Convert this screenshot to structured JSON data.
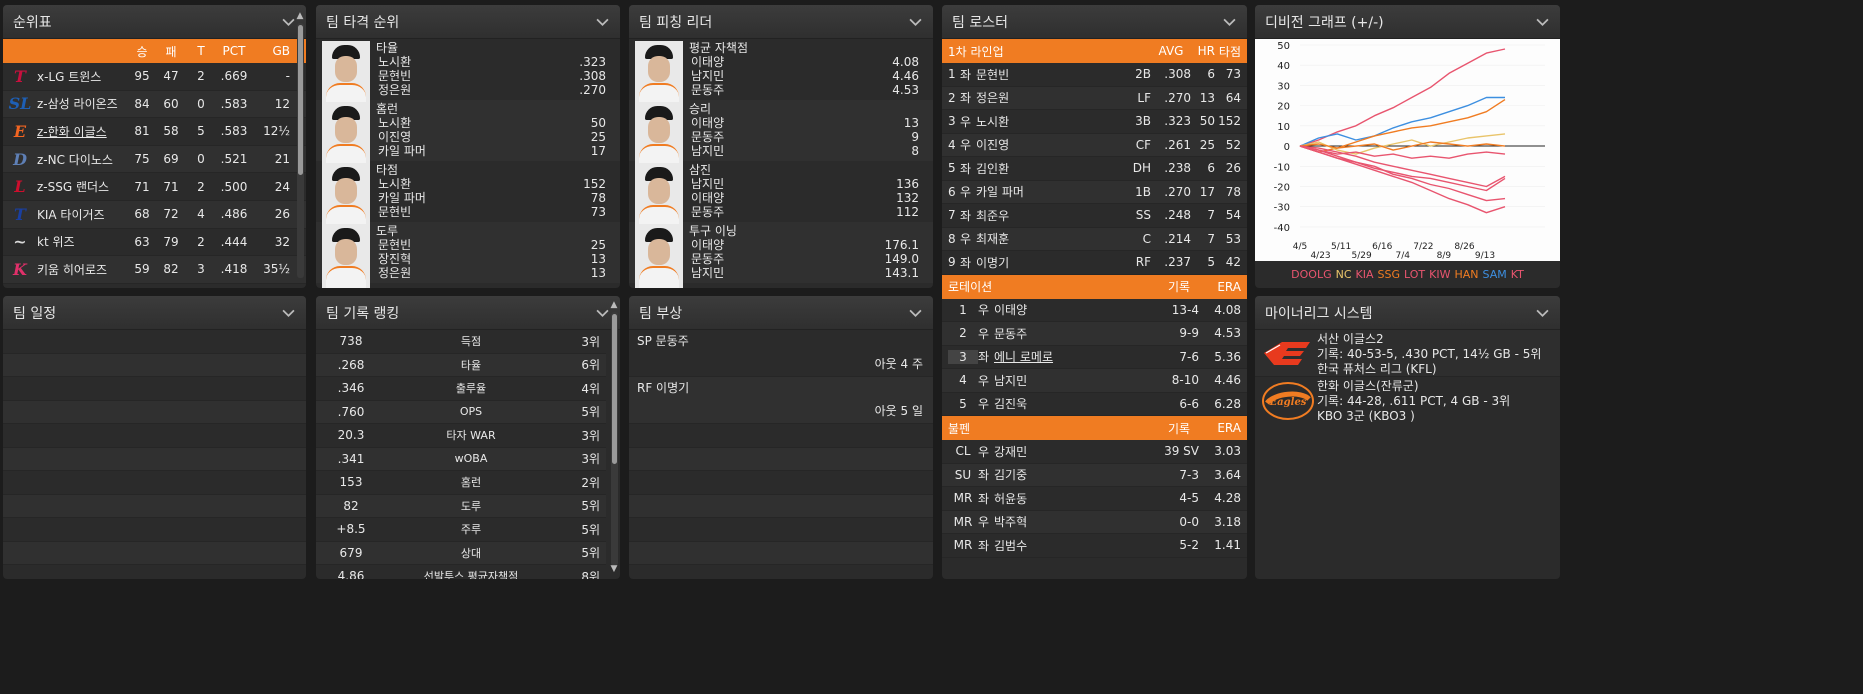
{
  "standings": {
    "title": "순위표",
    "headers": [
      "승",
      "패",
      "T",
      "PCT",
      "GB"
    ],
    "rows": [
      {
        "logo": "T",
        "logo_color": "#c8103e",
        "name": "x-LG 트윈스",
        "w": "95",
        "l": "47",
        "t": "2",
        "pct": ".669",
        "gb": "-"
      },
      {
        "logo": "SL",
        "logo_color": "#1e5fb5",
        "name": "z-삼성 라이온즈",
        "w": "84",
        "l": "60",
        "t": "0",
        "pct": ".583",
        "gb": "12"
      },
      {
        "logo": "E",
        "logo_color": "#f26522",
        "name": "z-한화 이글스",
        "w": "81",
        "l": "58",
        "t": "5",
        "pct": ".583",
        "gb": "12½"
      },
      {
        "logo": "D",
        "logo_color": "#5e7fb5",
        "name": "z-NC 다이노스",
        "w": "75",
        "l": "69",
        "t": "0",
        "pct": ".521",
        "gb": "21"
      },
      {
        "logo": "L",
        "logo_color": "#ce0e2d",
        "name": "z-SSG 랜더스",
        "w": "71",
        "l": "71",
        "t": "2",
        "pct": ".500",
        "gb": "24"
      },
      {
        "logo": "T",
        "logo_color": "#1a3fa0",
        "name": "KIA 타이거즈",
        "w": "68",
        "l": "72",
        "t": "4",
        "pct": ".486",
        "gb": "26"
      },
      {
        "logo": "~",
        "logo_color": "#d8d8d8",
        "name": "kt 위즈",
        "w": "63",
        "l": "79",
        "t": "2",
        "pct": ".444",
        "gb": "32"
      },
      {
        "logo": "K",
        "logo_color": "#e0306a",
        "name": "키움 히어로즈",
        "w": "59",
        "l": "82",
        "t": "3",
        "pct": ".418",
        "gb": "35½"
      }
    ]
  },
  "batting": {
    "title": "팀 타격 순위",
    "blocks": [
      {
        "cat": "타율",
        "lines": [
          {
            "name": "노시환",
            "val": ".323"
          },
          {
            "name": "문현빈",
            "val": ".308"
          },
          {
            "name": "정은원",
            "val": ".270"
          }
        ]
      },
      {
        "cat": "홈런",
        "lines": [
          {
            "name": "노시환",
            "val": "50"
          },
          {
            "name": "이진영",
            "val": "25"
          },
          {
            "name": "카일 파머",
            "val": "17"
          }
        ]
      },
      {
        "cat": "타점",
        "lines": [
          {
            "name": "노시환",
            "val": "152"
          },
          {
            "name": "카일 파머",
            "val": "78"
          },
          {
            "name": "문현빈",
            "val": "73"
          }
        ]
      },
      {
        "cat": "도루",
        "lines": [
          {
            "name": "문현빈",
            "val": "25"
          },
          {
            "name": "장진혁",
            "val": "13"
          },
          {
            "name": "정은원",
            "val": "13"
          }
        ]
      }
    ]
  },
  "pitching": {
    "title": "팀 피칭 리더",
    "blocks": [
      {
        "cat": "평균 자책점",
        "lines": [
          {
            "name": "이태양",
            "val": "4.08"
          },
          {
            "name": "남지민",
            "val": "4.46"
          },
          {
            "name": "문동주",
            "val": "4.53"
          }
        ]
      },
      {
        "cat": "승리",
        "lines": [
          {
            "name": "이태양",
            "val": "13"
          },
          {
            "name": "문동주",
            "val": "9"
          },
          {
            "name": "남지민",
            "val": "8"
          }
        ]
      },
      {
        "cat": "삼진",
        "lines": [
          {
            "name": "남지민",
            "val": "136"
          },
          {
            "name": "이태양",
            "val": "132"
          },
          {
            "name": "문동주",
            "val": "112"
          }
        ]
      },
      {
        "cat": "투구 이닝",
        "lines": [
          {
            "name": "이태양",
            "val": "176.1"
          },
          {
            "name": "문동주",
            "val": "149.0"
          },
          {
            "name": "남지민",
            "val": "143.1"
          }
        ]
      }
    ]
  },
  "roster": {
    "title": "팀 로스터",
    "lineup_header": {
      "label": "1차 라인업",
      "avg": "AVG",
      "hr": "HR",
      "rbi": "타점"
    },
    "lineup": [
      {
        "no": "1",
        "hand": "좌",
        "name": "문현빈",
        "pos": "2B",
        "avg": ".308",
        "hr": "6",
        "rbi": "73"
      },
      {
        "no": "2",
        "hand": "좌",
        "name": "정은원",
        "pos": "LF",
        "avg": ".270",
        "hr": "13",
        "rbi": "64"
      },
      {
        "no": "3",
        "hand": "우",
        "name": "노시환",
        "pos": "3B",
        "avg": ".323",
        "hr": "50",
        "rbi": "152"
      },
      {
        "no": "4",
        "hand": "우",
        "name": "이진영",
        "pos": "CF",
        "avg": ".261",
        "hr": "25",
        "rbi": "52"
      },
      {
        "no": "5",
        "hand": "좌",
        "name": "김인환",
        "pos": "DH",
        "avg": ".238",
        "hr": "6",
        "rbi": "26"
      },
      {
        "no": "6",
        "hand": "우",
        "name": "카일 파머",
        "pos": "1B",
        "avg": ".270",
        "hr": "17",
        "rbi": "78"
      },
      {
        "no": "7",
        "hand": "좌",
        "name": "최준우",
        "pos": "SS",
        "avg": ".248",
        "hr": "7",
        "rbi": "54"
      },
      {
        "no": "8",
        "hand": "우",
        "name": "최재훈",
        "pos": "C",
        "avg": ".214",
        "hr": "7",
        "rbi": "53"
      },
      {
        "no": "9",
        "hand": "좌",
        "name": "이명기",
        "pos": "RF",
        "avg": ".237",
        "hr": "5",
        "rbi": "42"
      }
    ],
    "rotation_header": {
      "label": "로테이션",
      "rec": "기록",
      "era": "ERA"
    },
    "rotation": [
      {
        "no": "1",
        "hand": "우",
        "name": "이태양",
        "rec": "13-4",
        "era": "4.08"
      },
      {
        "no": "2",
        "hand": "우",
        "name": "문동주",
        "rec": "9-9",
        "era": "4.53"
      },
      {
        "no": "3",
        "hand": "좌",
        "name": "에니 로메로",
        "rec": "7-6",
        "era": "5.36"
      },
      {
        "no": "4",
        "hand": "우",
        "name": "남지민",
        "rec": "8-10",
        "era": "4.46"
      },
      {
        "no": "5",
        "hand": "우",
        "name": "김진욱",
        "rec": "6-6",
        "era": "6.28"
      }
    ],
    "bullpen_header": {
      "label": "불펜",
      "rec": "기록",
      "era": "ERA"
    },
    "bullpen": [
      {
        "role": "CL",
        "hand": "우",
        "name": "강재민",
        "rec": "39 SV",
        "era": "3.03"
      },
      {
        "role": "SU",
        "hand": "좌",
        "name": "김기중",
        "rec": "7-3",
        "era": "3.64"
      },
      {
        "role": "MR",
        "hand": "좌",
        "name": "허윤동",
        "rec": "4-5",
        "era": "4.28"
      },
      {
        "role": "MR",
        "hand": "우",
        "name": "박주혁",
        "rec": "0-0",
        "era": "3.18"
      },
      {
        "role": "MR",
        "hand": "좌",
        "name": "김범수",
        "rec": "5-2",
        "era": "1.41"
      }
    ]
  },
  "division_graph": {
    "title": "디비전 그래프 (+/-)",
    "legend": [
      {
        "label": "DOOLG",
        "color": "#e8556f"
      },
      {
        "label": "NC",
        "color": "#e9c46a"
      },
      {
        "label": "KIA",
        "color": "#e8556f"
      },
      {
        "label": "SSG",
        "color": "#f07c22"
      },
      {
        "label": "LOT",
        "color": "#e8556f"
      },
      {
        "label": "KIW",
        "color": "#e8556f"
      },
      {
        "label": "HAN",
        "color": "#f07c22"
      },
      {
        "label": "SAM",
        "color": "#3d8fe0"
      },
      {
        "label": "KT",
        "color": "#e8556f"
      }
    ]
  },
  "chart_data": {
    "type": "line",
    "title": "디비전 그래프 (+/-)",
    "x_ticks": [
      "4/5",
      "4/23",
      "5/11",
      "5/29",
      "6/16",
      "7/4",
      "7/22",
      "8/9",
      "8/26",
      "9/13"
    ],
    "y_ticks": [
      50,
      40,
      30,
      20,
      10,
      0,
      -10,
      -20,
      -30,
      -40
    ],
    "ylim": [
      -45,
      50
    ],
    "series": [
      {
        "name": "LG",
        "color": "#e8556f",
        "values": [
          0,
          3,
          7,
          10,
          15,
          19,
          24,
          29,
          36,
          41,
          46,
          48
        ]
      },
      {
        "name": "SAM",
        "color": "#3d8fe0",
        "values": [
          0,
          4,
          6,
          3,
          5,
          9,
          12,
          14,
          17,
          20,
          24,
          24
        ]
      },
      {
        "name": "HAN",
        "color": "#f07c22",
        "values": [
          0,
          -3,
          -1,
          2,
          5,
          7,
          9,
          10,
          12,
          14,
          17,
          23
        ]
      },
      {
        "name": "NC",
        "color": "#e9c46a",
        "values": [
          0,
          2,
          -2,
          -4,
          -1,
          1,
          3,
          0,
          2,
          4,
          5,
          6
        ]
      },
      {
        "name": "SSG",
        "color": "#f07c22",
        "values": [
          0,
          1,
          -1,
          0,
          1,
          -2,
          0,
          2,
          1,
          0,
          1,
          0
        ]
      },
      {
        "name": "KIA",
        "color": "#e8556f",
        "values": [
          0,
          -2,
          -4,
          -3,
          -5,
          -4,
          -6,
          -5,
          -6,
          -4,
          -3,
          -4
        ]
      },
      {
        "name": "DOO",
        "color": "#e8556f",
        "values": [
          0,
          -1,
          -3,
          -5,
          -8,
          -10,
          -12,
          -14,
          -16,
          -18,
          -20,
          -15
        ]
      },
      {
        "name": "KT",
        "color": "#e8556f",
        "values": [
          0,
          -3,
          -6,
          -8,
          -11,
          -13,
          -15,
          -16,
          -18,
          -20,
          -22,
          -16
        ]
      },
      {
        "name": "LOT",
        "color": "#e8556f",
        "values": [
          0,
          -2,
          -5,
          -8,
          -10,
          -14,
          -16,
          -19,
          -21,
          -24,
          -27,
          -26
        ]
      },
      {
        "name": "KIW",
        "color": "#e8556f",
        "values": [
          0,
          -3,
          -6,
          -9,
          -12,
          -15,
          -18,
          -22,
          -26,
          -29,
          -33,
          -30
        ]
      }
    ]
  },
  "schedule": {
    "title": "팀 일정"
  },
  "records": {
    "title": "팀 기록 랭킹",
    "rows": [
      {
        "val": "738",
        "cat": "득점",
        "rank": "3위"
      },
      {
        "val": ".268",
        "cat": "타율",
        "rank": "6위"
      },
      {
        "val": ".346",
        "cat": "출루율",
        "rank": "4위"
      },
      {
        "val": ".760",
        "cat": "OPS",
        "rank": "5위"
      },
      {
        "val": "20.3",
        "cat": "타자 WAR",
        "rank": "3위"
      },
      {
        "val": ".341",
        "cat": "wOBA",
        "rank": "3위"
      },
      {
        "val": "153",
        "cat": "홈런",
        "rank": "2위"
      },
      {
        "val": "82",
        "cat": "도루",
        "rank": "5위"
      },
      {
        "val": "+8.5",
        "cat": "주루",
        "rank": "5위"
      },
      {
        "val": "679",
        "cat": "상대",
        "rank": "5위"
      },
      {
        "val": "4.86",
        "cat": "선발투스 평균자책점",
        "rank": "8위"
      }
    ]
  },
  "injuries": {
    "title": "팀 부상",
    "items": [
      {
        "player": "SP 문동주",
        "status": "아웃 4 주"
      },
      {
        "player": "RF 이명기",
        "status": "아웃 5 일"
      }
    ]
  },
  "minors": {
    "title": "마이너리그 시스템",
    "teams": [
      {
        "name": "서산 이글스2",
        "record": "기록: 40-53-5, .430 PCT, 14½ GB - 5위",
        "league": "한국 퓨처스 리그 (KFL)"
      },
      {
        "name": "한화 이글스(잔류군)",
        "record": "기록: 44-28, .611 PCT, 4 GB - 3위",
        "league": "KBO 3군 (KBO3 )"
      }
    ]
  }
}
